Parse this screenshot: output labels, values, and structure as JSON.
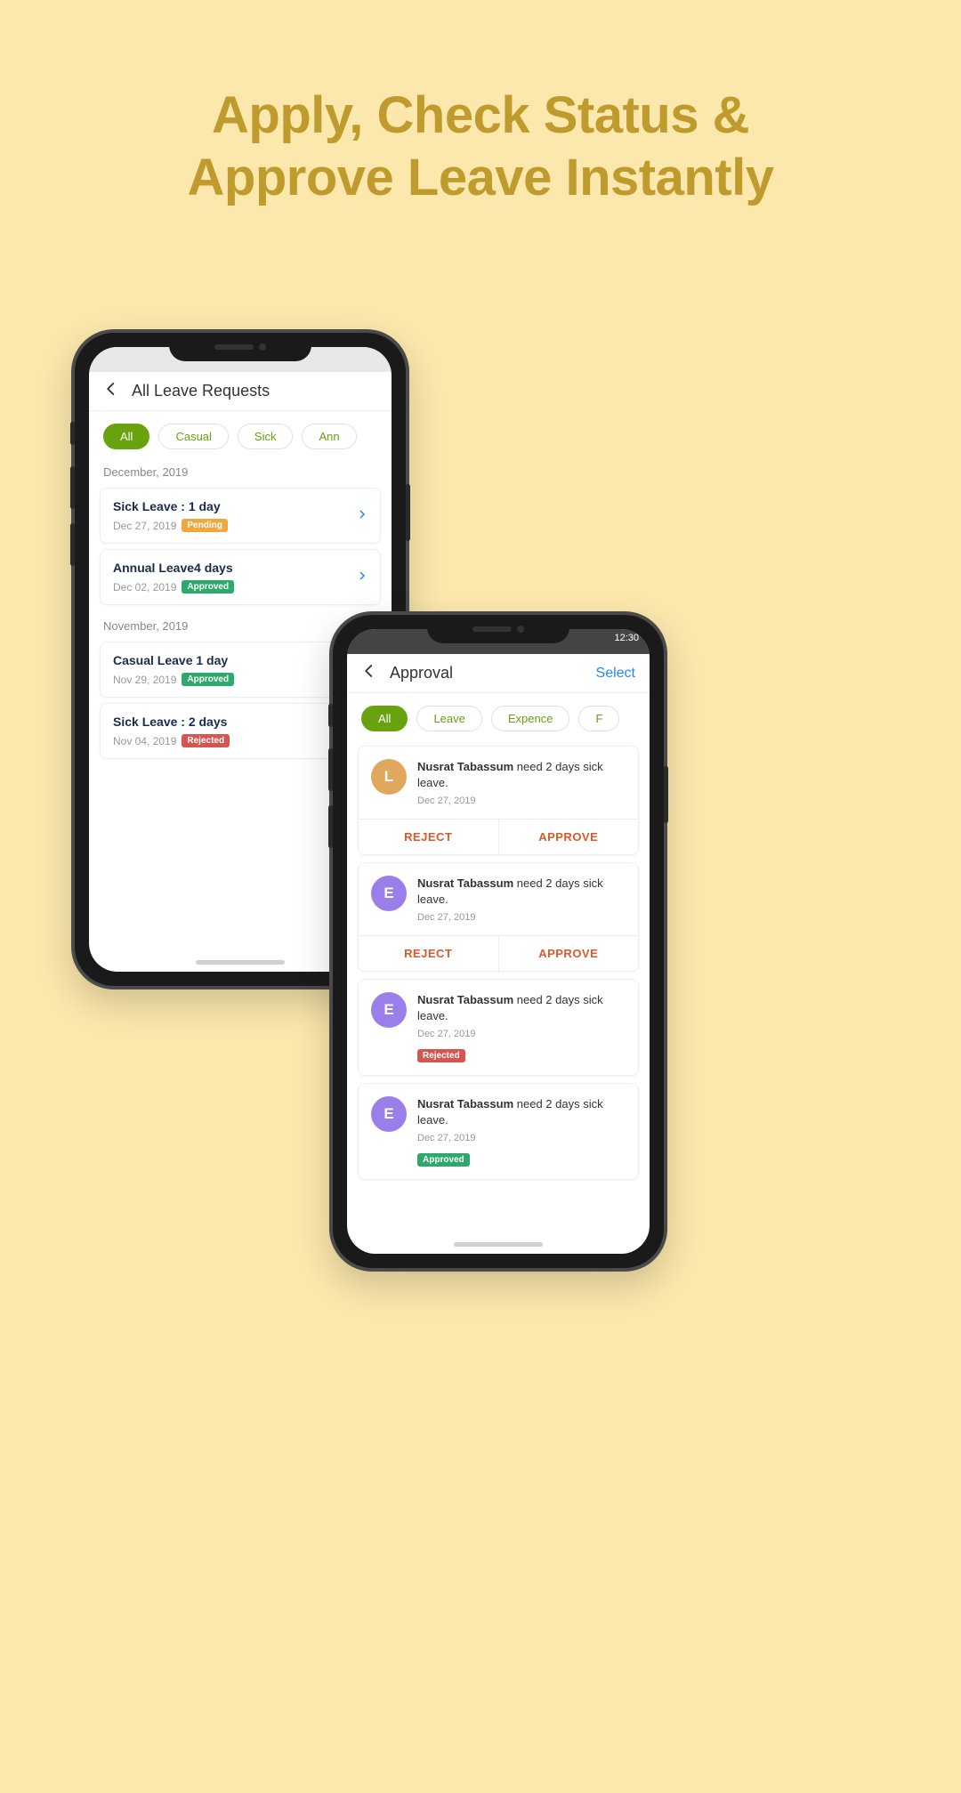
{
  "hero": {
    "line1": "Apply, Check Status &",
    "line2": "Approve Leave Instantly"
  },
  "phone1": {
    "header_title": "All Leave Requests",
    "filters": [
      "All",
      "Casual",
      "Sick",
      "Ann"
    ],
    "sections": [
      {
        "label": "December, 2019",
        "items": [
          {
            "title": "Sick Leave  :  1 day",
            "date": "Dec 27, 2019",
            "status": "Pending",
            "status_class": "pending",
            "chevron": true
          },
          {
            "title": "Annual Leave4 days",
            "date": "Dec 02, 2019",
            "status": "Approved",
            "status_class": "approved",
            "chevron": true
          }
        ]
      },
      {
        "label": "November, 2019",
        "items": [
          {
            "title": "Casual Leave 1 day",
            "date": "Nov 29, 2019",
            "status": "Approved",
            "status_class": "approved",
            "chevron": false
          },
          {
            "title": "Sick Leave  :  2 days",
            "date": "Nov 04, 2019",
            "status": "Rejected",
            "status_class": "rejected",
            "chevron": false
          }
        ]
      }
    ]
  },
  "phone2": {
    "header_title": "Approval",
    "select_label": "Select",
    "status_time": "12:30",
    "filters": [
      "All",
      "Leave",
      "Expence",
      "F"
    ],
    "reject_label": "REJECT",
    "approve_label": "APPROVE",
    "requests": [
      {
        "avatar_letter": "L",
        "avatar_class": "orange",
        "name": "Nusrat Tabassum",
        "rest": " need 2 days sick leave.",
        "date": "Dec 27, 2019",
        "has_actions": true
      },
      {
        "avatar_letter": "E",
        "avatar_class": "violet",
        "name": "Nusrat Tabassum",
        "rest": " need 2 days sick leave.",
        "date": "Dec 27, 2019",
        "has_actions": true
      },
      {
        "avatar_letter": "E",
        "avatar_class": "violet",
        "name": "Nusrat Tabassum",
        "rest": " need 2 days sick leave.",
        "date": "Dec 27, 2019",
        "has_actions": false,
        "status": "Rejected",
        "status_class": "rejected"
      },
      {
        "avatar_letter": "E",
        "avatar_class": "violet",
        "name": "Nusrat Tabassum",
        "rest": " need 2 days sick leave.",
        "date": "Dec 27, 2019",
        "has_actions": false,
        "status": "Approved",
        "status_class": "approved"
      }
    ]
  }
}
